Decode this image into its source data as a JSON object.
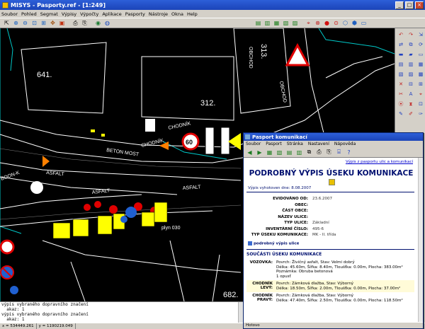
{
  "app": {
    "title": "MISYS - Pasporty.ref - [1:249]",
    "window_buttons": [
      "_",
      "□",
      "×"
    ]
  },
  "menu": [
    "Soubor",
    "Pohled",
    "Segmat",
    "Výpisy",
    "Výpočty",
    "Aplikace",
    "Pasporty",
    "Nástroje",
    "Okna",
    "Help"
  ],
  "toolbar_icons": [
    "zoom-in-icon",
    "zoom-out-icon",
    "zoom-window-icon",
    "zoom-all-icon",
    "pan-icon",
    "print-icon",
    "globe-icon",
    "earth-icon"
  ],
  "map": {
    "parcel_numbers": [
      "641.",
      "312.",
      "313.",
      "682."
    ],
    "street_labels": [
      "BETON MOST",
      "CHODNÍK",
      "ASFALT",
      "ASFALT",
      "ASFALT",
      "OBCHOD",
      "OBCHOD",
      "plyn 030",
      "CHODNÍK",
      "BOON-K"
    ],
    "speed_sign": "60",
    "colors": {
      "background": "#000000",
      "lines": "#ffffff",
      "parcel_lines": "#00c8c8",
      "signs_yellow": "#ffff00",
      "arrow_orange": "#ff8000"
    }
  },
  "command_line": {
    "lines": [
      "výpis vybraného dopravního značení",
      "  akaz: 1",
      "výpis vybraného dopravního značení",
      "  akaz: 1"
    ]
  },
  "statusbar": {
    "x": "x = 534449.261",
    "y": "y = 1190219.049"
  },
  "child": {
    "title": "Pasport komunikací",
    "menu": [
      "Soubor",
      "Pasport",
      "Stránka",
      "Nastavení",
      "Nápověda"
    ],
    "back_link": "Výpis z pasportu ulic a komunikací",
    "header": "PODROBNÝ VÝPIS ÚSEKU KOMUNIKACE",
    "generated": "Výpis vyhotoven dne: 8.08.2007",
    "fields": [
      {
        "label": "EVIDOVÁNO OD:",
        "value": "23.6.2007"
      },
      {
        "label": "OBEC:",
        "value": ""
      },
      {
        "label": "ČÁST OBCE:",
        "value": ""
      },
      {
        "label": "NÁZEV ULICE:",
        "value": ""
      },
      {
        "label": "TYP ULICE:",
        "value": "Základní"
      },
      {
        "label": "INVENTÁRNÍ ČÍSLO:",
        "value": "495-6"
      },
      {
        "label": "TYP ÚSEKU KOMUNIKACE:",
        "value": "MK - II. třída"
      }
    ],
    "detail_link": "podrobný výpis ulice",
    "section": "SOUČÁSTI ÚSEKU KOMUNIKACE",
    "parts": [
      {
        "label": "VOZOVKA:",
        "lines": [
          "Povrch: Živičný asfalt, Stav: Velmi dobrý",
          "Délka: 45.60m, Šířka: 8.40m, Tloušťka: 0.00m, Plocha: 383.00m²",
          "Poznámka: Obruba betonová",
          "1 opusť"
        ]
      },
      {
        "label": "CHODNÍK LEVÝ:",
        "lines": [
          "Povrch: Zámková dlažba, Stav: Výborný",
          "Délka: 18.50m, Šířka: 2.00m, Tloušťka: 0.00m, Plocha: 37.00m²"
        ]
      },
      {
        "label": "CHODNÍK PRAVÝ:",
        "lines": [
          "Povrch: Zámková dlažba, Stav: Výborný",
          "Délka: 47.40m, Šířka: 2.50m, Tloušťka: 0.00m, Plocha: 118.50m²"
        ]
      }
    ],
    "status": "Hotovo"
  }
}
